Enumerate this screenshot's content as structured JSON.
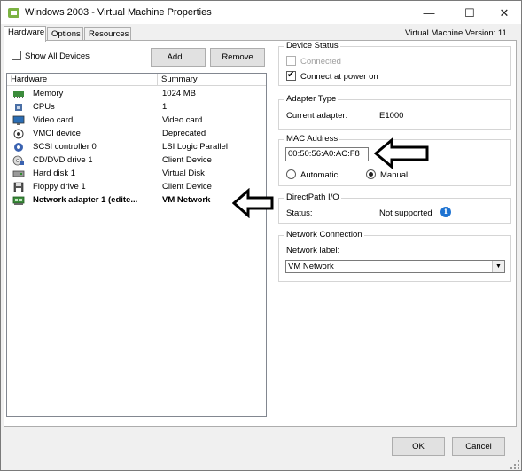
{
  "window": {
    "title": "Windows 2003 - Virtual Machine Properties",
    "minimize_glyph": "—",
    "maximize_glyph": "☐",
    "close_glyph": "✕"
  },
  "tabs": [
    {
      "label": "Hardware",
      "active": true
    },
    {
      "label": "Options",
      "active": false
    },
    {
      "label": "Resources",
      "active": false
    }
  ],
  "vm_version": "Virtual Machine Version: 11",
  "hardware": {
    "show_all_label": "Show All Devices",
    "show_all_checked": false,
    "add_label": "Add...",
    "remove_label": "Remove",
    "columns": {
      "hardware": "Hardware",
      "summary": "Summary"
    },
    "rows": [
      {
        "name": "Memory",
        "summary": "1024 MB",
        "icon": "memory-icon"
      },
      {
        "name": "CPUs",
        "summary": "1",
        "icon": "cpu-icon"
      },
      {
        "name": "Video card",
        "summary": "Video card",
        "icon": "monitor-icon"
      },
      {
        "name": "VMCI device",
        "summary": "Deprecated",
        "icon": "vmci-icon"
      },
      {
        "name": "SCSI controller 0",
        "summary": "LSI Logic Parallel",
        "icon": "scsi-icon"
      },
      {
        "name": "CD/DVD drive 1",
        "summary": "Client Device",
        "icon": "cd-icon"
      },
      {
        "name": "Hard disk 1",
        "summary": "Virtual Disk",
        "icon": "hard-disk-icon"
      },
      {
        "name": "Floppy drive 1",
        "summary": "Client Device",
        "icon": "floppy-icon"
      },
      {
        "name": "Network adapter 1 (edite...",
        "summary": "VM Network",
        "icon": "network-adapter-icon",
        "selected": true
      }
    ]
  },
  "device_status": {
    "title": "Device Status",
    "connected_label": "Connected",
    "connected_checked": false,
    "connect_power_label": "Connect at power on",
    "connect_power_checked": true,
    "check_glyph": "✔"
  },
  "adapter_type": {
    "title": "Adapter Type",
    "current_label": "Current adapter:",
    "current_value": "E1000"
  },
  "mac_address": {
    "title": "MAC Address",
    "value": "00:50:56:A0:AC:F8",
    "automatic_label": "Automatic",
    "manual_label": "Manual",
    "selected": "manual"
  },
  "directpath": {
    "title": "DirectPath I/O",
    "status_label": "Status:",
    "status_value": "Not supported",
    "info_glyph": "i"
  },
  "network_connection": {
    "title": "Network Connection",
    "label": "Network label:",
    "value": "VM Network",
    "arrow_glyph": "▼"
  },
  "footer": {
    "ok_label": "OK",
    "cancel_label": "Cancel"
  },
  "colors": {
    "info_blue": "#1e73d2",
    "panel_border": "#adadad",
    "button_bg": "#e1e1e1"
  }
}
